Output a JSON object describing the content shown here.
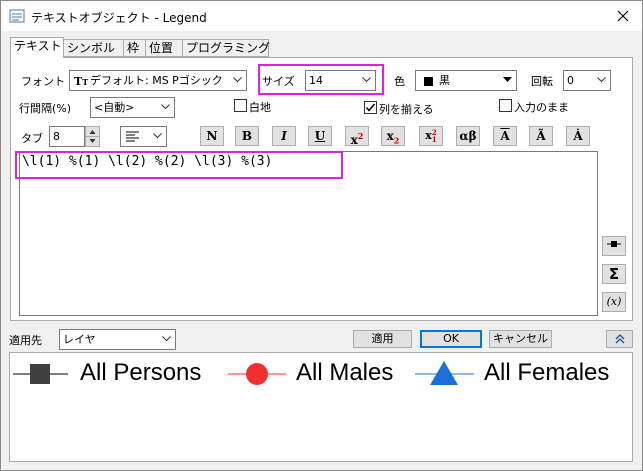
{
  "window": {
    "title": "テキストオブジェクト - Legend"
  },
  "tabs": [
    {
      "label": "テキスト"
    },
    {
      "label": "シンボル"
    },
    {
      "label": "枠"
    },
    {
      "label": "位置"
    },
    {
      "label": "プログラミング"
    }
  ],
  "text_tab": {
    "font_label": "フォント",
    "font_value": "デフォルト: MS Pゴシック",
    "size_label": "サイズ",
    "size_value": "14",
    "color_label": "色",
    "color_value": "黒",
    "color_swatch": "#000000",
    "rotation_label": "回転",
    "rotation_value": "0",
    "line_spacing_label": "行間隔(%)",
    "line_spacing_value": "<自動>",
    "white_bg_label": "白地",
    "white_bg_checked": false,
    "align_columns_label": "列を揃える",
    "align_columns_checked": true,
    "keep_input_label": "入力のまま",
    "keep_input_checked": false,
    "tab_label": "タブ",
    "tab_value": "8",
    "format_buttons": {
      "normal": "N",
      "bold": "B",
      "italic": "I",
      "underline": "U",
      "greek": "αβ",
      "bar": "A",
      "tilde": "Ã",
      "dot": "Ȧ"
    },
    "editor_text": "\\l(1) %(1) \\l(2) %(2) \\l(3) %(3)"
  },
  "bottom": {
    "apply_to_label": "適用先",
    "apply_to_value": "レイヤ",
    "apply_button": "適用",
    "ok_button": "OK",
    "cancel_button": "キャンセル"
  },
  "legend_preview": {
    "items": [
      {
        "label": "All Persons",
        "symbol": "square",
        "color": "#404040",
        "line_color": "#000000"
      },
      {
        "label": "All Males",
        "symbol": "circle",
        "color": "#f03030",
        "line_color": "#f03030"
      },
      {
        "label": "All Females",
        "symbol": "triangle",
        "color": "#1e6fd9",
        "line_color": "#1e6fd9"
      }
    ]
  },
  "colors": {
    "highlight": "#e020e0",
    "accent": "#0078d7"
  }
}
